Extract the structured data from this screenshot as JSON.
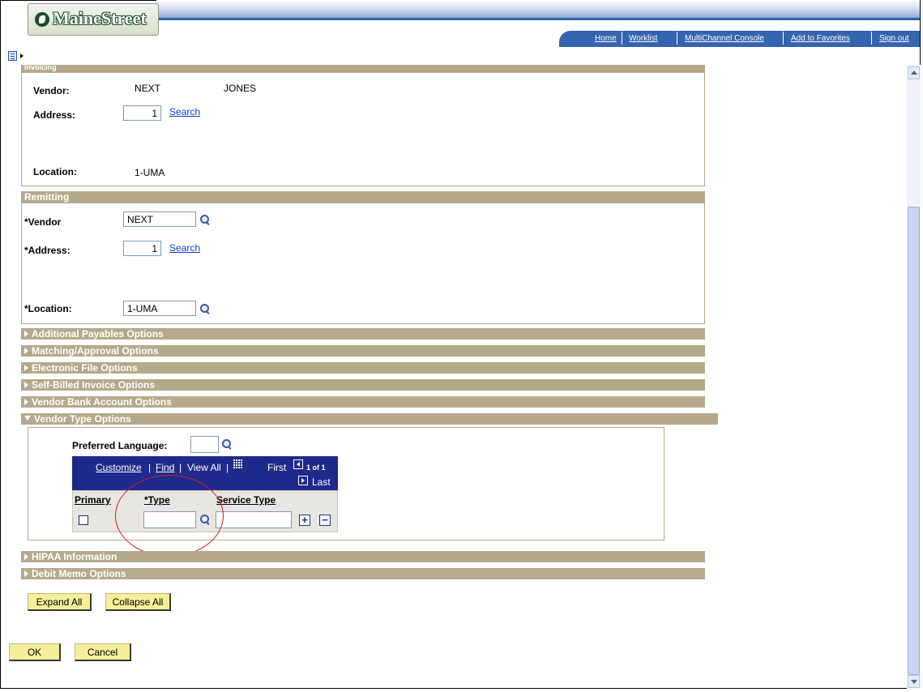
{
  "header": {
    "logo_text": "MaineStreet",
    "links": [
      "Home",
      "Worklist",
      "MultiChannel Console",
      "Add to Favorites",
      "Sign out"
    ]
  },
  "invoicing": {
    "title": "Invoicing",
    "vendor_label": "Vendor:",
    "vendor_id": "NEXT",
    "vendor_name": "JONES",
    "address_label": "Address:",
    "address_value": "1",
    "search_link": "Search",
    "location_label": "Location:",
    "location_value": "1-UMA"
  },
  "remitting": {
    "title": "Remitting",
    "vendor_label": "*Vendor",
    "vendor_value": "NEXT",
    "address_label": "*Address:",
    "address_value": "1",
    "search_link": "Search",
    "location_label": "*Location:",
    "location_value": "1-UMA"
  },
  "collapsed_sections": [
    "Additional Payables Options",
    "Matching/Approval Options",
    "Electronic File Options",
    "Self-Billed Invoice Options",
    "Vendor Bank Account Options"
  ],
  "vendor_type": {
    "title": "Vendor Type Options",
    "preferred_language_label": "Preferred Language:",
    "preferred_language_value": "",
    "grid": {
      "customize": "Customize",
      "sep1": "|",
      "find": "Find",
      "sep2": "|",
      "view_all": "View All",
      "sep3": "|",
      "first": "First",
      "count": "1 of 1",
      "last": "Last",
      "columns": [
        "Primary",
        "*Type",
        "Service Type"
      ],
      "row": {
        "primary_checked": false,
        "type": "",
        "service_type": ""
      },
      "add_symbol": "+",
      "delete_symbol": "−"
    }
  },
  "collapsed_sections_after": [
    "HIPAA Information",
    "Debit Memo Options"
  ],
  "buttons": {
    "expand_all": "Expand All",
    "collapse_all": "Collapse All",
    "ok": "OK",
    "cancel": "Cancel"
  },
  "colors": {
    "section_bar": "#b6a98b",
    "grid_header": "#1e2a8c",
    "link": "#1440c7",
    "button_face": "#f5ef9a",
    "annotation_circle": "#d21f1f"
  }
}
